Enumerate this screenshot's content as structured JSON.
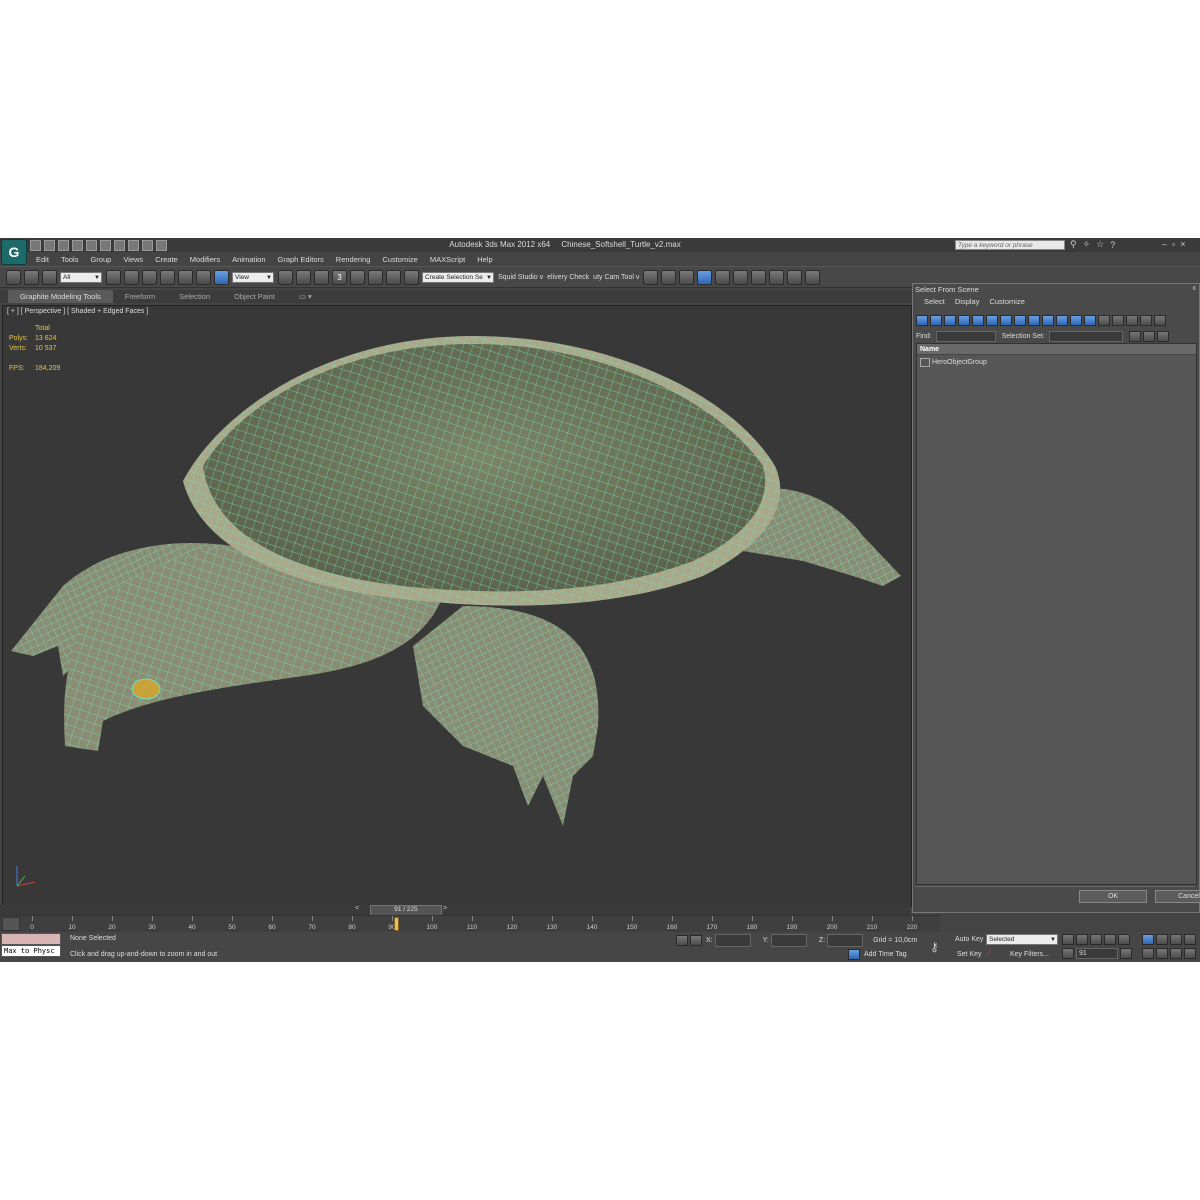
{
  "window": {
    "app_name": "Autodesk 3ds Max  2012 x64",
    "file_name": "Chinese_Softshell_Turtle_v2.max",
    "search_placeholder": "Type a keyword or phrase",
    "logo_letter": "G"
  },
  "menu": [
    "Edit",
    "Tools",
    "Group",
    "Views",
    "Create",
    "Modifiers",
    "Animation",
    "Graph Editors",
    "Rendering",
    "Customize",
    "MAXScript",
    "Help"
  ],
  "toolbar": {
    "filter_value": "All",
    "refcoord_value": "View",
    "snap_label": "3",
    "named_selection": "Create Selection Se",
    "plugin_labels": [
      "Squid Studio v",
      "elivery Check",
      "uty Cam Tool v"
    ]
  },
  "ribbon": {
    "tabs": [
      "Graphite Modeling Tools",
      "Freeform",
      "Selection",
      "Object Paint"
    ],
    "active_tab": 0
  },
  "viewport": {
    "label": "[ + ] [ Perspective ] [ Shaded + Edged Faces ]",
    "stats": {
      "total_label": "Total",
      "polys_label": "Polys:",
      "polys_value": "13 624",
      "verts_label": "Verts:",
      "verts_value": "10 537",
      "fps_label": "FPS:",
      "fps_value": "184,209"
    },
    "wire_color": "#6fe0c8",
    "shell_color": "#6f7a5c",
    "body_color": "#8a8d72"
  },
  "panel": {
    "title": "Select From Scene",
    "close": "x",
    "menu": [
      "Select",
      "Display",
      "Customize"
    ],
    "find_label": "Find:",
    "selection_set_label": "Selection Set:",
    "column_name": "Name",
    "items": [
      "HeroObjectGroup"
    ],
    "ok_label": "OK",
    "cancel_label": "Cancel"
  },
  "timeline": {
    "frame_counter": "91 / 225",
    "current_frame": 91,
    "total_frames": 225,
    "ticks": [
      "0",
      "10",
      "20",
      "30",
      "40",
      "50",
      "60",
      "70",
      "80",
      "90",
      "100",
      "110",
      "120",
      "130",
      "140",
      "150",
      "160",
      "170",
      "180",
      "190",
      "200",
      "210",
      "220"
    ],
    "prev": "<",
    "next": ">"
  },
  "status": {
    "maxscript_text": "Max to Physc",
    "selection_status": "None Selected",
    "prompt": "Click and drag up-and-down to zoom in and out",
    "x_label": "X:",
    "y_label": "Y:",
    "z_label": "Z:",
    "grid": "Grid = 10,0cm",
    "add_time_tag": "Add Time Tag",
    "auto_key": "Auto Key",
    "set_key": "Set Key",
    "key_mode_value": "Selected",
    "key_filters": "Key Filters...",
    "current_frame_field": "91"
  }
}
